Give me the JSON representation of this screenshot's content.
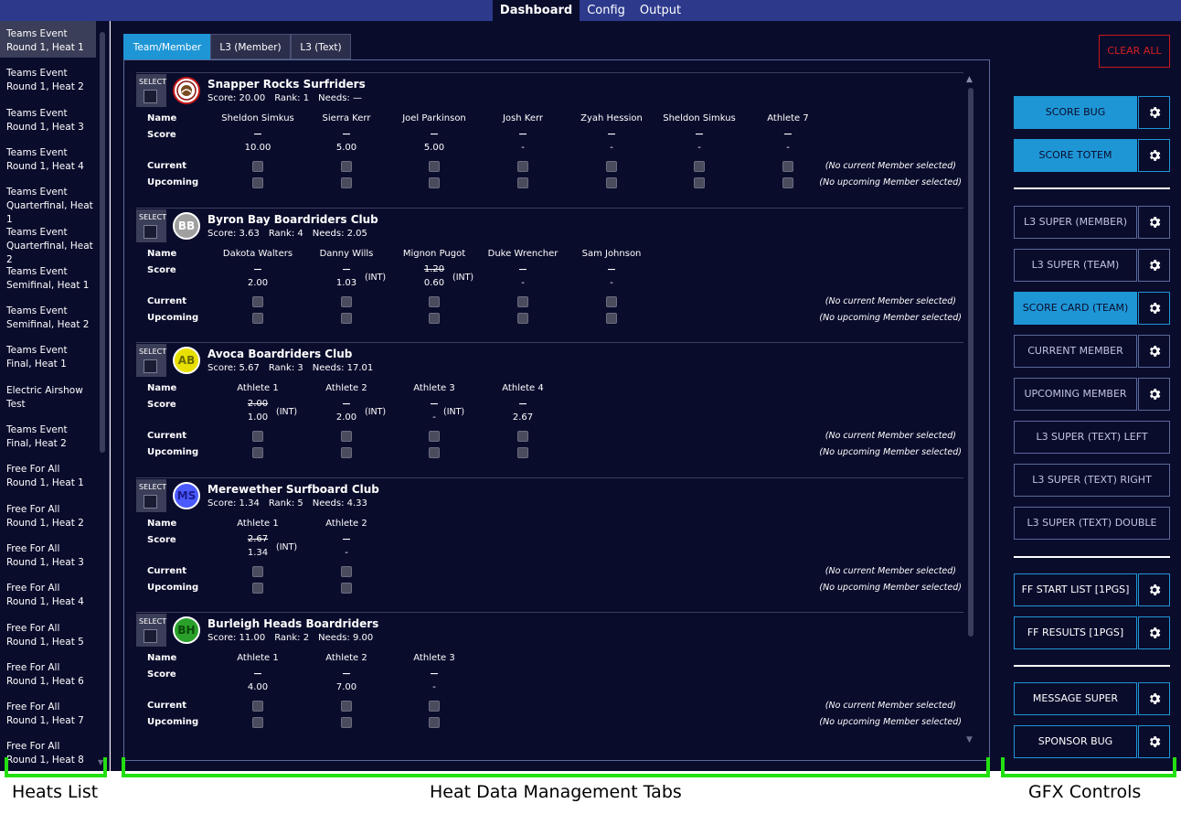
{
  "nav": {
    "tabs": [
      "Dashboard",
      "Config",
      "Output"
    ],
    "active": "Dashboard"
  },
  "heats": [
    {
      "l1": "Teams Event",
      "l2": "Round 1, Heat 1",
      "selected": true
    },
    {
      "l1": "Teams Event",
      "l2": "Round 1, Heat 2"
    },
    {
      "l1": "Teams Event",
      "l2": "Round 1, Heat 3"
    },
    {
      "l1": "Teams Event",
      "l2": "Round 1, Heat 4"
    },
    {
      "l1": "Teams Event",
      "l2": "Quarterfinal, Heat 1"
    },
    {
      "l1": "Teams Event",
      "l2": "Quarterfinal, Heat 2"
    },
    {
      "l1": "Teams Event",
      "l2": "Semifinal, Heat 1"
    },
    {
      "l1": "Teams Event",
      "l2": "Semifinal, Heat 2"
    },
    {
      "l1": "Teams Event",
      "l2": "Final, Heat 1"
    },
    {
      "l1": "Electric Airshow",
      "l2": "Test"
    },
    {
      "l1": "Teams Event",
      "l2": "Final, Heat 2"
    },
    {
      "l1": "Free For All",
      "l2": "Round 1, Heat 1"
    },
    {
      "l1": "Free For All",
      "l2": "Round 1, Heat 2"
    },
    {
      "l1": "Free For All",
      "l2": "Round 1, Heat 3"
    },
    {
      "l1": "Free For All",
      "l2": "Round 1, Heat 4"
    },
    {
      "l1": "Free For All",
      "l2": "Round 1, Heat 5"
    },
    {
      "l1": "Free For All",
      "l2": "Round 1, Heat 6"
    },
    {
      "l1": "Free For All",
      "l2": "Round 1, Heat 7"
    },
    {
      "l1": "Free For All",
      "l2": "Round 1, Heat 8"
    }
  ],
  "tabs": [
    "Team/Member",
    "L3 (Member)",
    "L3 (Text)"
  ],
  "labels": {
    "select": "SELECT",
    "name": "Name",
    "score": "Score",
    "current": "Current",
    "upcoming": "Upcoming",
    "no_current": "(No current Member selected)",
    "no_upcoming": "(No upcoming Member selected)",
    "score_prefix": "Score: ",
    "rank_prefix": "Rank: ",
    "needs_prefix": "Needs: "
  },
  "teams": [
    {
      "name": "Snapper Rocks Surfriders",
      "score": "20.00",
      "rank": "1",
      "needs": "—",
      "logo": "",
      "logo_bg": "#ffffff",
      "logo_fg": "#c41a1a",
      "logo_type": "emblem",
      "members": [
        {
          "name": "Sheldon Simkus",
          "prev": "",
          "score": "10.00",
          "int": false
        },
        {
          "name": "Sierra Kerr",
          "prev": "",
          "score": "5.00",
          "int": false
        },
        {
          "name": "Joel Parkinson",
          "prev": "",
          "score": "5.00",
          "int": false
        },
        {
          "name": "Josh Kerr",
          "prev": "",
          "score": "-",
          "int": false
        },
        {
          "name": "Zyah Hession",
          "prev": "",
          "score": "-",
          "int": false
        },
        {
          "name": "Sheldon Simkus",
          "prev": "",
          "score": "-",
          "int": false
        },
        {
          "name": "Athlete 7",
          "prev": "",
          "score": "-",
          "int": false
        }
      ]
    },
    {
      "name": "Byron Bay Boardriders Club",
      "score": "3.63",
      "rank": "4",
      "needs": "2.05",
      "logo": "BB",
      "logo_bg": "#a0a0a0",
      "logo_fg": "#ffffff",
      "members": [
        {
          "name": "Dakota Walters",
          "prev": "",
          "score": "2.00",
          "int": false
        },
        {
          "name": "Danny Wills",
          "prev": "",
          "score": "1.03",
          "int": true
        },
        {
          "name": "Mignon Pugot",
          "prev": "1.20",
          "score": "0.60",
          "int": true
        },
        {
          "name": "Duke Wrencher",
          "prev": "",
          "score": "-",
          "int": false
        },
        {
          "name": "Sam Johnson",
          "prev": "",
          "score": "-",
          "int": false
        }
      ]
    },
    {
      "name": "Avoca Boardriders Club",
      "score": "5.67",
      "rank": "3",
      "needs": "17.01",
      "logo": "AB",
      "logo_bg": "#e8e000",
      "logo_fg": "#6a6a00",
      "members": [
        {
          "name": "Athlete 1",
          "prev": "2.00",
          "score": "1.00",
          "int": true
        },
        {
          "name": "Athlete 2",
          "prev": "",
          "score": "2.00",
          "int": true
        },
        {
          "name": "Athlete 3",
          "prev": "",
          "score": "-",
          "int": true
        },
        {
          "name": "Athlete 4",
          "prev": "",
          "score": "2.67",
          "int": false
        }
      ]
    },
    {
      "name": "Merewether Surfboard Club",
      "score": "1.34",
      "rank": "5",
      "needs": "4.33",
      "logo": "MS",
      "logo_bg": "#4a5aff",
      "logo_fg": "#1a1a8a",
      "members": [
        {
          "name": "Athlete 1",
          "prev": "2.67",
          "score": "1.34",
          "int": true
        },
        {
          "name": "Athlete 2",
          "prev": "",
          "score": "-",
          "int": false
        }
      ]
    },
    {
      "name": "Burleigh Heads Boardriders",
      "score": "11.00",
      "rank": "2",
      "needs": "9.00",
      "logo": "BH",
      "logo_bg": "#2aa02a",
      "logo_fg": "#0a4a0a",
      "members": [
        {
          "name": "Athlete 1",
          "prev": "",
          "score": "4.00",
          "int": false
        },
        {
          "name": "Athlete 2",
          "prev": "",
          "score": "7.00",
          "int": false
        },
        {
          "name": "Athlete 3",
          "prev": "",
          "score": "-",
          "int": false
        }
      ]
    }
  ],
  "int_label": "(INT)",
  "gfx": {
    "clear_all": "CLEAR ALL",
    "buttons": [
      {
        "label": "SCORE BUG",
        "on": true,
        "gear": true,
        "group": 0
      },
      {
        "label": "SCORE TOTEM",
        "on": true,
        "gear": true,
        "group": 0
      },
      {
        "label": "L3 SUPER (MEMBER)",
        "on": false,
        "gear": true,
        "group": 1
      },
      {
        "label": "L3 SUPER (TEAM)",
        "on": false,
        "gear": true,
        "group": 1
      },
      {
        "label": "SCORE CARD (TEAM)",
        "on": true,
        "gear": true,
        "group": 1
      },
      {
        "label": "CURRENT MEMBER",
        "on": false,
        "gear": true,
        "group": 1
      },
      {
        "label": "UPCOMING MEMBER",
        "on": false,
        "gear": true,
        "group": 1
      },
      {
        "label": "L3 SUPER (TEXT) LEFT",
        "on": false,
        "gear": false,
        "group": 1
      },
      {
        "label": "L3 SUPER (TEXT) RIGHT",
        "on": false,
        "gear": false,
        "group": 1
      },
      {
        "label": "L3 SUPER (TEXT) DOUBLE",
        "on": false,
        "gear": false,
        "group": 1
      },
      {
        "label": "FF START LIST [1PGS]",
        "on": false,
        "gear": true,
        "group": 2,
        "white": true
      },
      {
        "label": "FF RESULTS [1PGS]",
        "on": false,
        "gear": true,
        "group": 2,
        "white": true
      },
      {
        "label": "MESSAGE SUPER",
        "on": false,
        "gear": true,
        "group": 3,
        "white": true
      },
      {
        "label": "SPONSOR BUG",
        "on": false,
        "gear": true,
        "group": 3,
        "white": true
      }
    ]
  },
  "annotations": [
    "Heats List",
    "Heat Data Management Tabs",
    "GFX Controls"
  ],
  "colors": {
    "bg": "#0a0c2c",
    "nav": "#2d3a8c",
    "accent": "#1e96d6",
    "danger": "#d42020",
    "annotation": "#22e010"
  }
}
